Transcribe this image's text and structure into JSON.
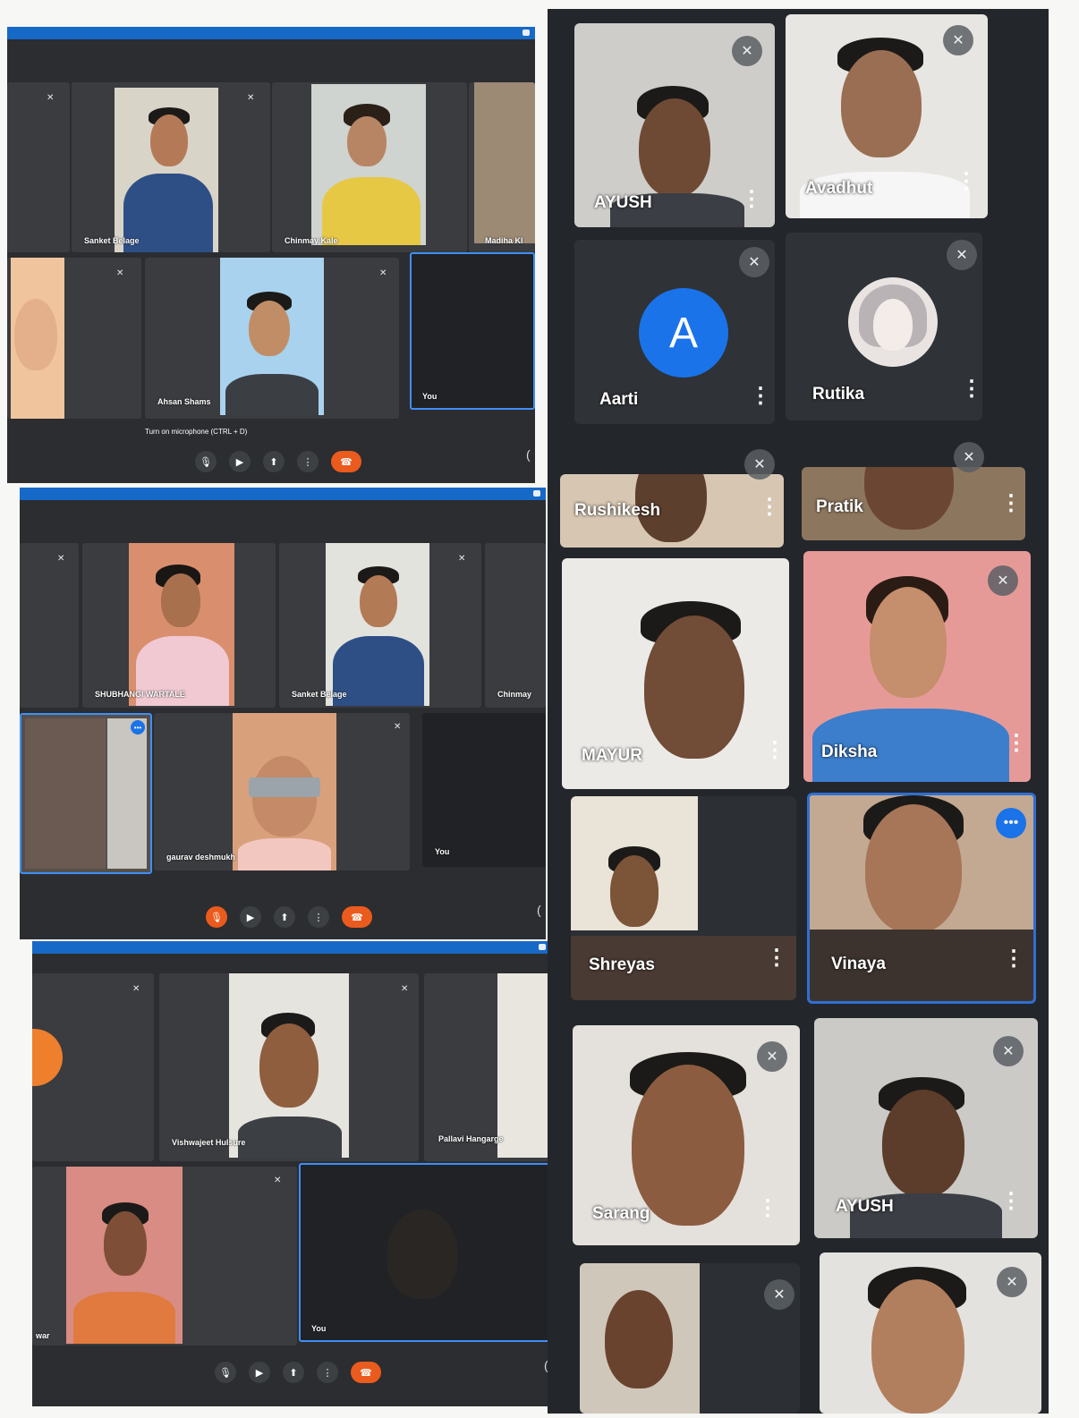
{
  "left_panels": [
    {
      "tiles": [
        "Sanket Belage",
        "Chinmay Kale",
        "Madiha Kl",
        "Ahsan Shams",
        "You"
      ],
      "tooltip": "Turn on microphone (CTRL + D)"
    },
    {
      "tiles": [
        "SHUBHANGI WARTALE",
        "Sanket Belage",
        "Chinmay",
        "gaurav deshmukh",
        "You"
      ]
    },
    {
      "tiles": [
        "Vishwajeet Hulsure",
        "Pallavi Hangarge",
        "war",
        "You"
      ]
    }
  ],
  "right_grid": [
    {
      "name": "AYUSH"
    },
    {
      "name": "Avadhut"
    },
    {
      "name": "Aarti",
      "avatar_letter": "A"
    },
    {
      "name": "Rutika"
    },
    {
      "name": "Rushikesh"
    },
    {
      "name": "Pratik"
    },
    {
      "name": "MAYUR"
    },
    {
      "name": "Diksha"
    },
    {
      "name": "Shreyas"
    },
    {
      "name": "Vinaya"
    },
    {
      "name": "Sarang"
    },
    {
      "name": "AYUSH"
    },
    {
      "name": ""
    },
    {
      "name": ""
    }
  ],
  "colors": {
    "accent": "#1769c7",
    "end_call": "#ea5b1d",
    "avatar_blue": "#1a73e8"
  }
}
